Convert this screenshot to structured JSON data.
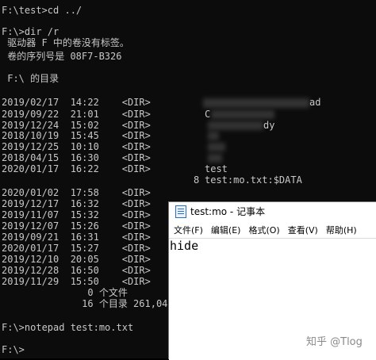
{
  "console": {
    "lines": [
      "F:\\test>cd ../",
      "",
      "F:\\>dir /r",
      " 驱动器 F 中的卷没有标签。",
      " 卷的序列号是 08F7-B326",
      "",
      " F:\\ 的目录",
      "",
      "2019/02/17  14:22    <DIR>",
      "2019/09/22  21:01    <DIR>",
      "2019/12/24  15:02    <DIR>",
      "2018/10/19  15:45    <DIR>",
      "2019/12/25  10:10    <DIR>",
      "2018/04/15  16:30    <DIR>",
      "2020/01/17  16:22    <DIR>",
      "",
      "2020/01/02  17:58    <DIR>",
      "2019/12/17  16:32    <DIR>",
      "2019/11/07  15:32    <DIR>",
      "2019/12/07  15:26    <DIR>",
      "2019/09/21  16:31    <DIR>",
      "2020/01/17  15:27    <DIR>",
      "2019/12/10  20:05    <DIR>",
      "2019/12/28  16:50    <DIR>",
      "2019/11/29  15:50    <DIR>",
      "               0 个文件",
      "              16 个目录 261,04",
      "",
      "F:\\>notepad test:mo.txt",
      "",
      "F:\\>"
    ],
    "right_column": {
      "blurred_line_1_suffix": "ad",
      "blurred_line_2_prefix": "C",
      "blurred_line_3_suffix": "dy",
      "test_name": "test",
      "stream_size": "8",
      "stream_name": "test:mo.txt:$DATA"
    }
  },
  "notepad": {
    "title": "test:mo - 记事本",
    "menu": [
      "文件(F)",
      "编辑(E)",
      "格式(O)",
      "查看(V)",
      "帮助(H)"
    ],
    "content": "hide"
  },
  "watermark": "知乎 @Tlog"
}
